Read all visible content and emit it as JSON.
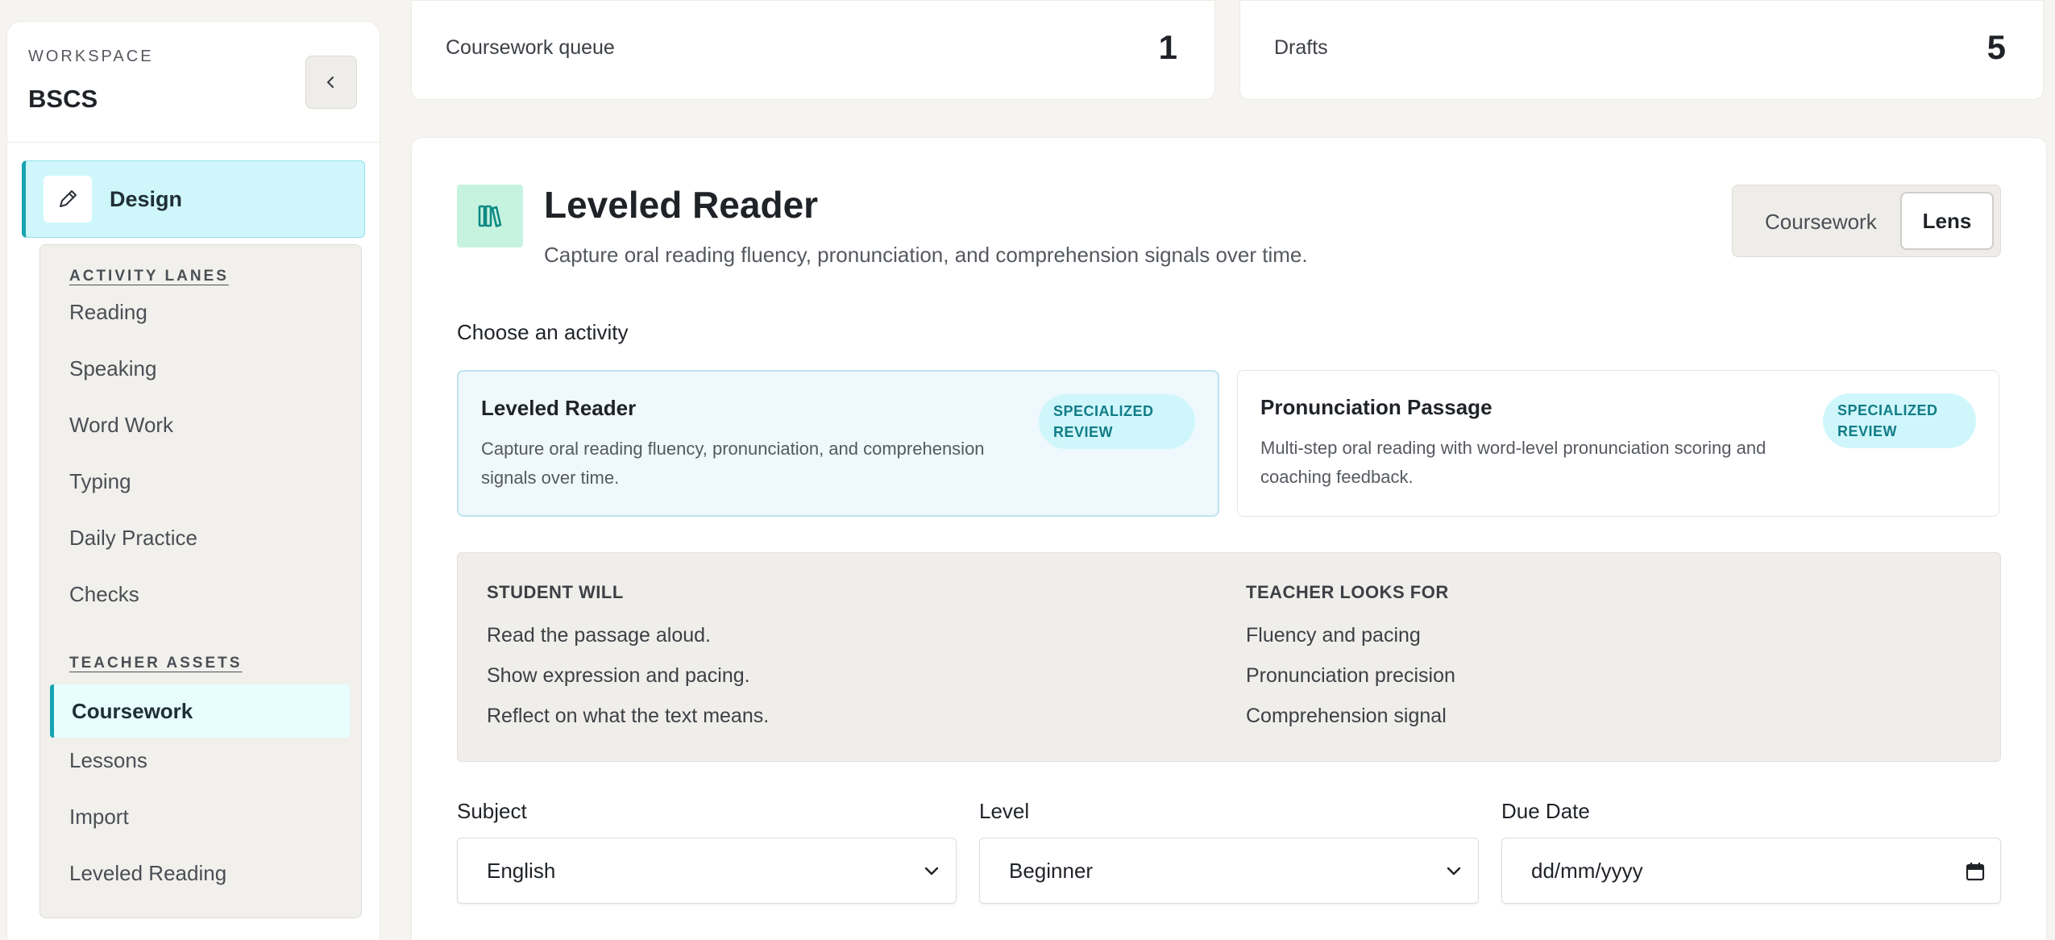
{
  "sidebar": {
    "workspace_label": "WORKSPACE",
    "workspace_name": "BSCS",
    "design_label": "Design",
    "activity_lanes_label": "ACTIVITY LANES",
    "activity_lanes": [
      "Reading",
      "Speaking",
      "Word Work",
      "Typing",
      "Daily Practice",
      "Checks"
    ],
    "teacher_assets_label": "TEACHER ASSETS",
    "teacher_assets": {
      "active": "Coursework",
      "others": [
        "Lessons",
        "Import",
        "Leveled Reading"
      ]
    }
  },
  "stats": [
    {
      "label": "Coursework queue",
      "value": "1"
    },
    {
      "label": "Drafts",
      "value": "5"
    }
  ],
  "hero": {
    "title": "Leveled Reader",
    "description": "Capture oral reading fluency, pronunciation, and comprehension signals over time."
  },
  "view_toggle": {
    "options": [
      "Coursework",
      "Lens"
    ],
    "selected": "Lens"
  },
  "choose_label": "Choose an activity",
  "activities": [
    {
      "title": "Leveled Reader",
      "description": "Capture oral reading fluency, pronunciation, and comprehension signals over time.",
      "badge": "SPECIALIZED REVIEW",
      "selected": true
    },
    {
      "title": "Pronunciation Passage",
      "description": "Multi-step oral reading with word-level pronunciation scoring and coaching feedback.",
      "badge": "SPECIALIZED REVIEW",
      "selected": false
    }
  ],
  "student_will": {
    "heading": "STUDENT WILL",
    "items": [
      "Read the passage aloud.",
      "Show expression and pacing.",
      "Reflect on what the text means."
    ]
  },
  "teacher_looks_for": {
    "heading": "TEACHER LOOKS FOR",
    "items": [
      "Fluency and pacing",
      "Pronunciation precision",
      "Comprehension signal"
    ]
  },
  "form": {
    "subject": {
      "label": "Subject",
      "value": "English"
    },
    "level": {
      "label": "Level",
      "value": "Beginner"
    },
    "due_date": {
      "label": "Due Date",
      "placeholder": "dd/mm/yyyy"
    }
  },
  "colors": {
    "accent": "#17a4b0",
    "accent_light": "#cff7fb",
    "badge_text": "#127c87",
    "hero_icon_bg": "#c6f3df",
    "selected_card_bg": "#eef8fd",
    "page_bg": "#f5f4f0"
  },
  "icons": {
    "collapse": "chevron-left-icon",
    "design": "pencil-icon",
    "hero": "books-icon",
    "select": "chevron-down-icon",
    "calendar": "calendar-icon"
  }
}
